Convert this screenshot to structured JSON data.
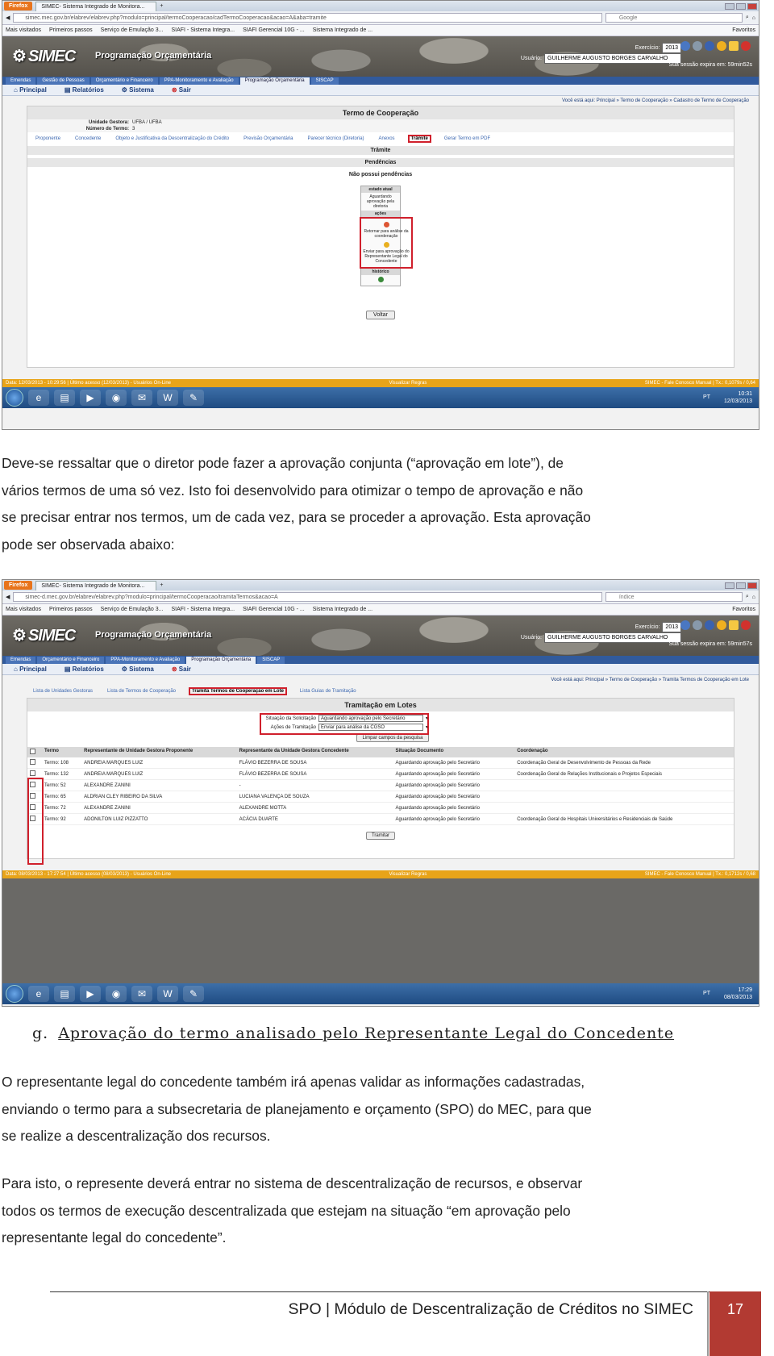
{
  "shot1": {
    "browser": {
      "menu_button": "Firefox",
      "tab_title": "SIMEC- Sistema Integrado de Monitora...",
      "url": "simec.mec.gov.br/elabrev/elabrev.php?modulo=principal/termoCooperacao/cadTermoCooperacao&acao=A&aba=tramite",
      "search_placeholder": "Google",
      "bookmarks": [
        "Mais visitados",
        "Primeiros passos",
        "Serviço de Emulação 3...",
        "SIAFI - Sistema Integra...",
        "SIAFI Gerencial 10G - ...",
        "Sistema Integrado de ..."
      ],
      "favorites": "Favoritos"
    },
    "header": {
      "logo": "SIMEC",
      "title": "Programação Orçamentária",
      "exercicio_label": "Exercício:",
      "exercicio": "2013",
      "usuario_label": "Usuário:",
      "usuario": "GUILHERME AUGUSTO BORGES CARVALHO",
      "sessao": "Sua sessão expira em: 59min52s"
    },
    "module_tabs": [
      "Emendas",
      "Gestão de Pessoas",
      "Orçamentário e Financeiro",
      "PPA-Monitoramento e Avaliação",
      "Programação Orçamentária",
      "SISCAP"
    ],
    "submenu": [
      "Principal",
      "Relatórios",
      "Sistema",
      "Sair"
    ],
    "breadcrumb": "Você está aqui: Principal » Termo de Cooperação » Cadastro de Termo de Cooperação",
    "panel_title": "Termo de Cooperação",
    "fields": [
      {
        "label": "Unidade Gestora:",
        "value": "UFBA / UFBA"
      },
      {
        "label": "Número do Termo:",
        "value": "3"
      }
    ],
    "tabs": [
      "Proponente",
      "Concedente",
      "Objeto e Justificativa da Descentralização do Crédito",
      "Previsão Orçamentária",
      "Parecer técnico (Diretoria)",
      "Anexos",
      "Trâmite",
      "Gerar Termo em PDF"
    ],
    "tramite_title": "Trâmite",
    "pendencias_title": "Pendências",
    "pendencias_text": "Não possui pendências",
    "workflow": {
      "estado_label": "estado atual",
      "estado": "Aguardando aprovação pela diretoria",
      "acoes_label": "ações",
      "acao1": "Retornar para análise da coordenação",
      "acao2": "Enviar para aprovação do Representante Legal do Concedente",
      "historico_label": "histórico"
    },
    "voltar": "Voltar",
    "status_left": "Data: 12/03/2013 - 10:29:56 | Último acesso (12/03/2013) - Usuários On-Line",
    "status_mid": "Visualizar Regras",
    "status_right": "SIMEC - Fale Conosco Manual | Tx.: 0,1079s / 0,64",
    "clock_time": "10:31",
    "clock_date": "12/03/2013",
    "tray": "PT"
  },
  "paragraph1": [
    "Deve-se ressaltar que o diretor pode fazer a aprovação conjunta (“aprovação em lote”), de",
    "vários termos de uma só vez. Isto foi desenvolvido para otimizar o tempo de aprovação e não",
    "se precisar entrar nos termos, um de cada vez, para se proceder a aprovação. Esta aprovação",
    "pode ser observada abaixo:"
  ],
  "shot2": {
    "browser": {
      "menu_button": "Firefox",
      "tab_title": "SIMEC- Sistema Integrado de Monitora...",
      "url": "simec-d.mec.gov.br/elabrev/elabrev.php?modulo=principal/termoCooperacao/tramitaTermos&acao=A",
      "search_placeholder": "índice",
      "bookmarks": [
        "Mais visitados",
        "Primeiros passos",
        "Serviço de Emulação 3...",
        "SIAFI - Sistema Integra...",
        "SIAFI Gerencial 10G - ...",
        "Sistema Integrado de ..."
      ],
      "favorites": "Favoritos"
    },
    "header": {
      "logo": "SIMEC",
      "title": "Programação Orçamentária",
      "exercicio_label": "Exercício:",
      "exercicio": "2013",
      "usuario_label": "Usuário:",
      "usuario": "GUILHERME AUGUSTO BORGES CARVALHO",
      "sessao": "Sua sessão expira em: 59min57s"
    },
    "module_tabs": [
      "Emendas",
      "Orçamentário e Financeiro",
      "PPA-Monitoramento e Avaliação",
      "Programação Orçamentária",
      "SISCAP"
    ],
    "submenu": [
      "Principal",
      "Relatórios",
      "Sistema",
      "Sair"
    ],
    "breadcrumb": "Você está aqui: Principal » Termo de Cooperação » Tramita Termos de Cooperação em Lote",
    "tabs": [
      "Lista de Unidades Gestoras",
      "Lista de Termos de Cooperação",
      "Tramita Termos de Cooperação em Lote",
      "Lista Guias de Tramitação"
    ],
    "panel_title": "Tramitação em Lotes",
    "filters": [
      {
        "label": "Situação da Solicitação",
        "value": "Aguardando aprovação pelo Secretário"
      },
      {
        "label": "Ações de Tramitação",
        "value": "Enviar para análise da CGSO"
      }
    ],
    "limpar": "Limpar campos da pesquisa",
    "columns": [
      "Termo",
      "Representante de Unidade Gestora Proponente",
      "Representante da Unidade Gestora Concedente",
      "Situação Documento",
      "Coordenação"
    ],
    "rows": [
      [
        "Termo: 108",
        "ANDREIA MARQUES LUIZ",
        "FLÁVIO BEZERRA DE SOUSA",
        "Aguardando aprovação pelo Secretário",
        "Coordenação Geral de Desenvolvimento de Pessoas da Rede"
      ],
      [
        "Termo: 132",
        "ANDREIA MARQUES LUIZ",
        "FLÁVIO BEZERRA DE SOUSA",
        "Aguardando aprovação pelo Secretário",
        "Coordenação Geral de Relações Institucionais e Projetos Especiais"
      ],
      [
        "Termo: 52",
        "ALEXANDRE ZANINI",
        "-",
        "Aguardando aprovação pelo Secretário",
        ""
      ],
      [
        "Termo: 65",
        "ALDRIAN CLEY RIBEIRO DA SILVA",
        "LUCIANA VALENÇA DE SOUZA",
        "Aguardando aprovação pelo Secretário",
        ""
      ],
      [
        "Termo: 72",
        "ALEXANDRE ZANINI",
        "ALEXANDRE MOTTA",
        "Aguardando aprovação pelo Secretário",
        ""
      ],
      [
        "Termo: 92",
        "ADONILTON LUIZ PIZZATTO",
        "ACÁCIA DUARTE",
        "Aguardando aprovação pelo Secretário",
        "Coordenação Geral de Hospitais Universitários e Residenciais de Saúde"
      ]
    ],
    "tramitar": "Tramitar",
    "status_left": "Data: 08/03/2013 - 17:27:54 | Último acesso (08/03/2013) - Usuários On-Line",
    "status_mid": "Visualizar Regras",
    "status_right": "SIMEC - Fale Conosco Manual | Tx.: 0,1712s / 0,68",
    "clock_time": "17:29",
    "clock_date": "08/03/2013",
    "tray": "PT"
  },
  "heading": {
    "letter": "g.",
    "title": "Aprovação do termo analisado pelo Representante Legal do Concedente"
  },
  "paragraph2": [
    "O representante legal do concedente também irá apenas validar as informações cadastradas,",
    "enviando o termo para a subsecretaria de planejamento e orçamento (SPO) do MEC, para que",
    "se realize a descentralização dos recursos."
  ],
  "paragraph3": [
    "Para isto, o represente deverá entrar no sistema de descentralização de recursos, e observar",
    "todos os termos de execução descentralizada que estejam na situação “em aprovação pelo",
    "representante legal do concedente”."
  ],
  "footer": {
    "text": "SPO | Módulo de Descentralização de Créditos no SIMEC",
    "page": "17"
  }
}
